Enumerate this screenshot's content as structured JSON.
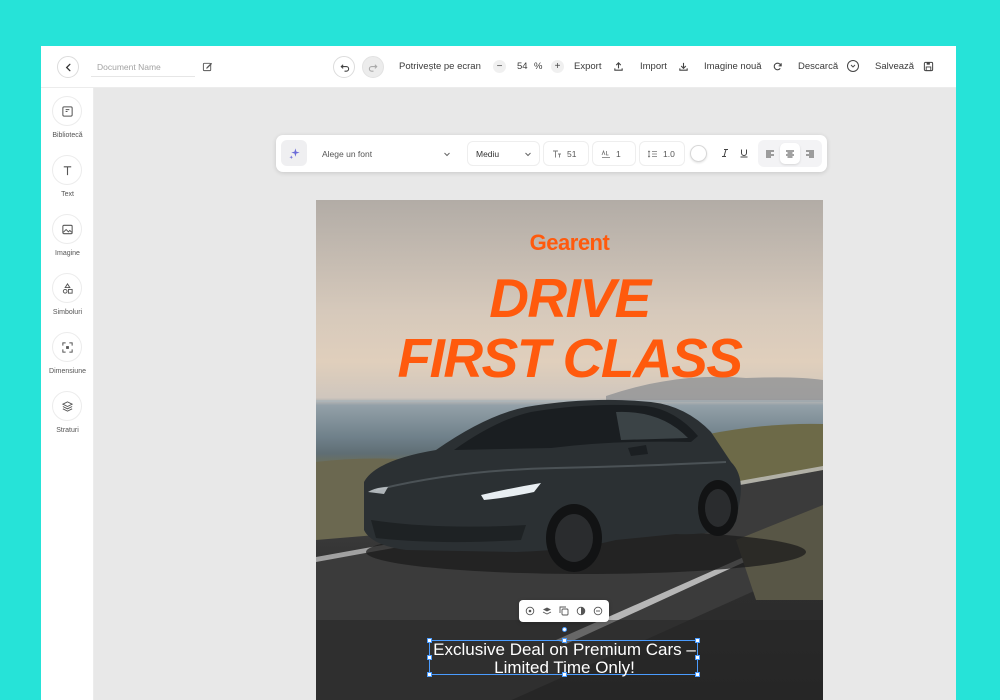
{
  "topbar": {
    "document_name_placeholder": "Document Name",
    "fit_screen_label": "Potrivește pe ecran",
    "zoom_value": "54",
    "zoom_unit": "%",
    "zoom_minus": "−",
    "zoom_plus": "+",
    "export_label": "Export",
    "import_label": "Import",
    "new_image_label": "Imagine nouă",
    "download_label": "Descarcă",
    "save_label": "Salvează"
  },
  "sidebar": {
    "items": [
      {
        "label": "Bibliotecă",
        "icon": "library-icon"
      },
      {
        "label": "Text",
        "icon": "text-icon"
      },
      {
        "label": "Imagine",
        "icon": "image-icon"
      },
      {
        "label": "Simboluri",
        "icon": "symbols-icon"
      },
      {
        "label": "Dimensiune",
        "icon": "dimension-icon"
      },
      {
        "label": "Straturi",
        "icon": "layers-icon"
      }
    ]
  },
  "font_toolbar": {
    "font_select": "Alege un font",
    "weight_select": "Mediu",
    "font_size": "51",
    "letter_spacing": "1",
    "line_height": "1.0",
    "text_color": "#ffffff"
  },
  "poster": {
    "brand": "Gearent",
    "headline_line1": "DRIVE",
    "headline_line2": "FIRST CLASS",
    "caption_line1": "Exclusive Deal on Premium Cars –",
    "caption_line2": "Limited Time Only!",
    "accent_color": "#ff5a0d"
  },
  "colors": {
    "background": "#26e3d8",
    "selection": "#4a9cff"
  }
}
